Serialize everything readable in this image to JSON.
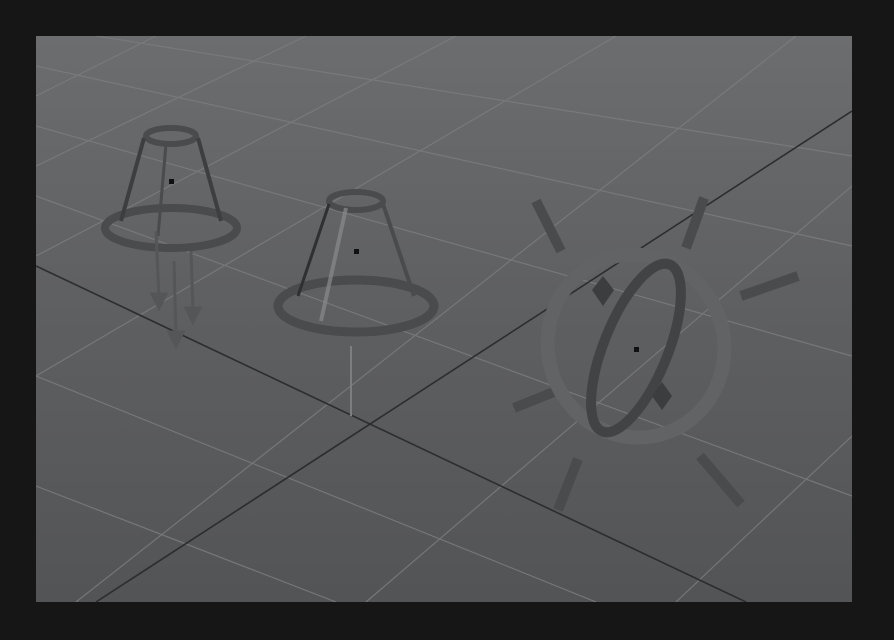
{
  "scene": {
    "name": "3D viewport",
    "lights": [
      {
        "name": "spot-light-left",
        "type": "spot"
      },
      {
        "name": "spot-light-center",
        "type": "spot"
      },
      {
        "name": "point-light-right",
        "type": "point"
      }
    ],
    "colors": {
      "background": "#161616",
      "viewport_top": "#6c6d6f",
      "viewport_bottom": "#535456",
      "grid_line": "#7a7b7d",
      "axis_line": "#2f3032",
      "light_gizmo": "#4a4b4d",
      "light_gizmo_highlight": "#8a8b8d"
    }
  }
}
